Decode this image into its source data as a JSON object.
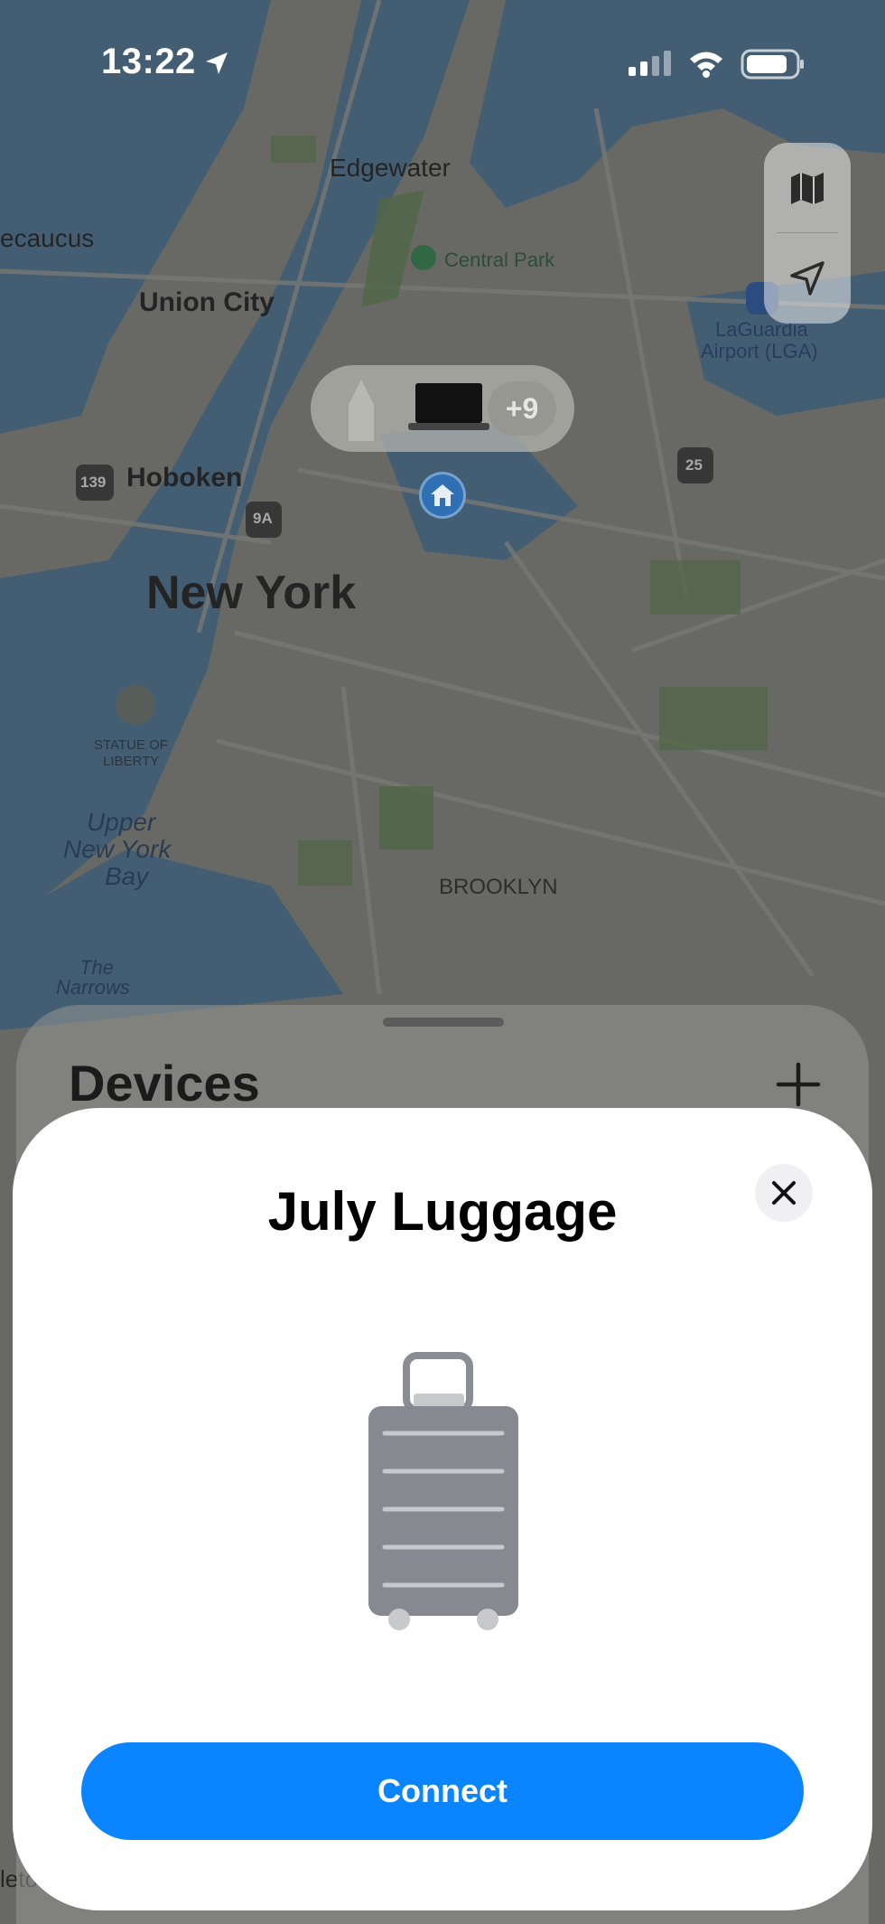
{
  "status_bar": {
    "time": "13:22"
  },
  "map": {
    "labels": {
      "edgewater": "Edgewater",
      "secaucus": "ecaucus",
      "union_city": "Union City",
      "central_park": "Central Park",
      "laguardia": "LaGuardia",
      "laguardia_sub": "Airport (LGA)",
      "hoboken": "Hoboken",
      "new_york": "New York",
      "statue": "STATUE OF",
      "statue_sub": "LIBERTY",
      "upper": "Upper",
      "new_york_bay1": "New York",
      "bay": "Bay",
      "the": "The",
      "narrows": "Narrows",
      "brooklyn": "BROOKLYN",
      "bottom_left": "leto"
    },
    "shields": {
      "route_139": "139",
      "route_9a": "9A",
      "route_25": "25"
    },
    "cluster_more": "+9"
  },
  "drawer": {
    "title": "Devices"
  },
  "sheet": {
    "title": "July Luggage",
    "connect_label": "Connect"
  },
  "icons": {
    "location": "location-arrow-icon",
    "map": "map-icon",
    "recenter": "navigation-arrow-icon",
    "home": "home-icon",
    "add": "plus-icon",
    "close": "close-icon",
    "luggage": "luggage-icon"
  },
  "colors": {
    "accent": "#0a84ff",
    "water": "#3b6f9a",
    "land": "#8a8c83",
    "park": "#5f8a4f"
  }
}
